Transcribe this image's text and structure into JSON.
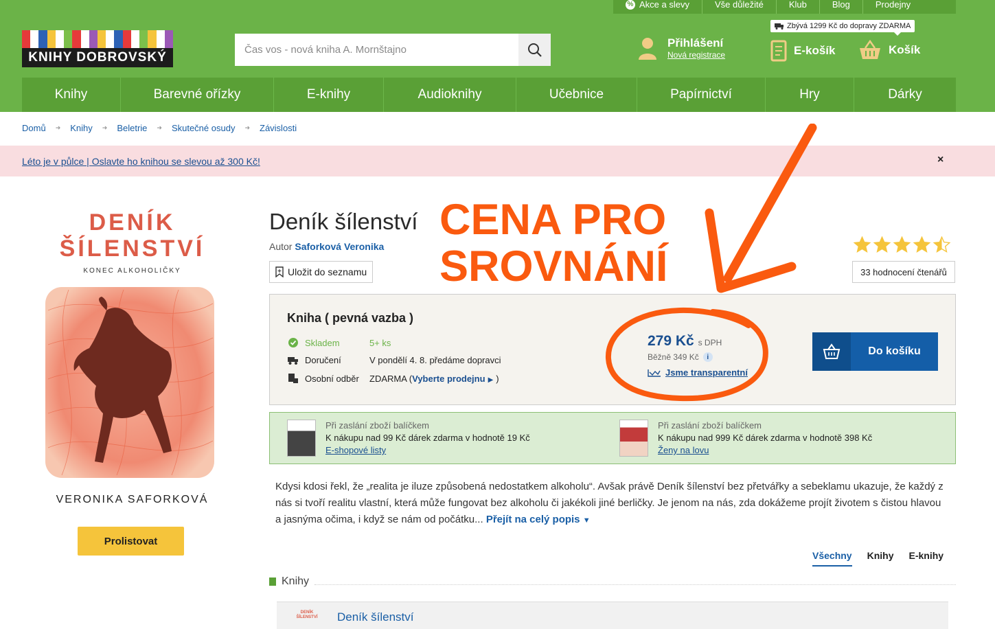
{
  "topbar": [
    {
      "label": "Akce a slevy",
      "icon": "percent-icon"
    },
    {
      "label": "Vše důležité"
    },
    {
      "label": "Klub"
    },
    {
      "label": "Blog"
    },
    {
      "label": "Prodejny"
    }
  ],
  "logo": {
    "text": "KNIHY DOBROVSKÝ",
    "stripe_colors": [
      "#e63a3a",
      "#ffffff",
      "#2d62b5",
      "#f5c43b",
      "#ffffff",
      "#7cc04b",
      "#e63a3a",
      "#ffffff",
      "#9b59b6",
      "#f5c43b",
      "#ffffff",
      "#2d62b5",
      "#e63a3a",
      "#ffffff",
      "#7cc04b",
      "#f5c43b",
      "#ffffff",
      "#9b59b6"
    ]
  },
  "search": {
    "placeholder": "Čas vos - nová kniha A. Mornštajno"
  },
  "account": {
    "login": "Přihlášení",
    "register": "Nová registrace"
  },
  "shipping_tooltip": "Zbývá 1299 Kč do dopravy ZDARMA",
  "ekosik": "E-košík",
  "kosik": "Košík",
  "nav": [
    "Knihy",
    "Barevné ořízky",
    "E-knihy",
    "Audioknihy",
    "Učebnice",
    "Papírnictví",
    "Hry",
    "Dárky"
  ],
  "breadcrumb": [
    "Domů",
    "Knihy",
    "Beletrie",
    "Skutečné osudy",
    "Závislosti"
  ],
  "promo": {
    "text": "Léto je v půlce | Oslavte ho knihou se slevou až 300 Kč!",
    "close": "×"
  },
  "cover": {
    "title_line1": "DENÍK",
    "title_line2": "ŠÍLENSTVÍ",
    "subtitle": "KONEC ALKOHOLIČKY",
    "author": "VERONIKA SAFORKOVÁ"
  },
  "prolistovat": "Prolistovat",
  "book": {
    "title": "Deník šílenství",
    "author_label": "Autor",
    "author": "Saforková Veronika",
    "save_label": "Uložit do seznamu"
  },
  "annotation": {
    "line1": "CENA PRO",
    "line2": "SROVNÁNÍ",
    "color": "#fa5a0f"
  },
  "rating": {
    "stars": 4.5,
    "max": 5,
    "count_label": "33 hodnocení čtenářů"
  },
  "product": {
    "format": "Kniha ( pevná vazba )",
    "stock_label": "Skladem",
    "stock_value": "5+ ks",
    "delivery_label": "Doručení",
    "delivery_value": "V pondělí 4. 8. předáme dopravci",
    "pickup_label": "Osobní odběr",
    "pickup_value": "ZDARMA (",
    "pickup_link": "Vyberte prodejnu",
    "pickup_end": ")",
    "price": "279 Kč",
    "price_suffix": "s DPH",
    "regular_price": "Běžně 349 Kč",
    "transparent": "Jsme transparentní",
    "cart_button": "Do košíku"
  },
  "gifts": [
    {
      "line1": "Při zaslání zboží balíčkem",
      "line2": "K nákupu nad 99 Kč dárek zdarma v hodnotě 19 Kč",
      "link": "E-shopové listy"
    },
    {
      "line1": "Při zaslání zboží balíčkem",
      "line2": "K nákupu nad 999 Kč dárek zdarma v hodnotě 398 Kč",
      "link": "Ženy na lovu"
    }
  ],
  "description": {
    "text": "Kdysi kdosi řekl, že „realita je iluze způsobená nedostatkem alkoholu“. Avšak právě Deník šílenství bez přetvářky a sebeklamu ukazuje, že každý z nás si tvoří realitu vlastní, která může fungovat bez alkoholu či jakékoli jiné berličky. Je jenom na nás, zda dokážeme projít životem s čistou hlavou a jasnýma očima, i když se nám od počátku...",
    "more": "Přejít na celý popis"
  },
  "format_tabs": [
    "Všechny",
    "Knihy",
    "E-knihy"
  ],
  "section_title": "Knihy",
  "bottom_item": {
    "title": "Deník šílenství",
    "mini_cover": "DENÍK ŠÍLENSTVÍ"
  }
}
